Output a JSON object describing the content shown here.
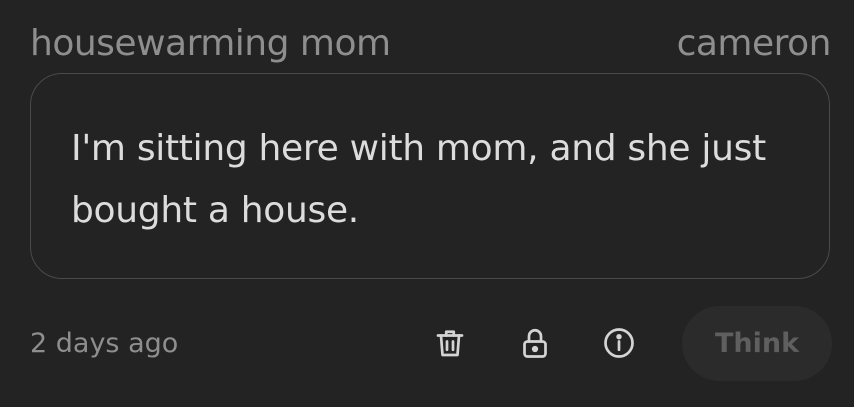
{
  "entry": {
    "title": "housewarming mom",
    "author": "cameron",
    "body": "I'm sitting here with mom, and she just bought a house.",
    "timestamp": "2 days ago"
  },
  "actions": {
    "delete_icon": "trash-icon",
    "lock_icon": "lock-icon",
    "info_icon": "info-icon",
    "think_label": "Think"
  },
  "colors": {
    "background": "#232323",
    "muted_text": "#8e8e8e",
    "body_text": "#dcdcdc",
    "card_border": "#4a4a4a",
    "button_bg": "#2b2b2b",
    "button_text": "#5f5f5f"
  }
}
